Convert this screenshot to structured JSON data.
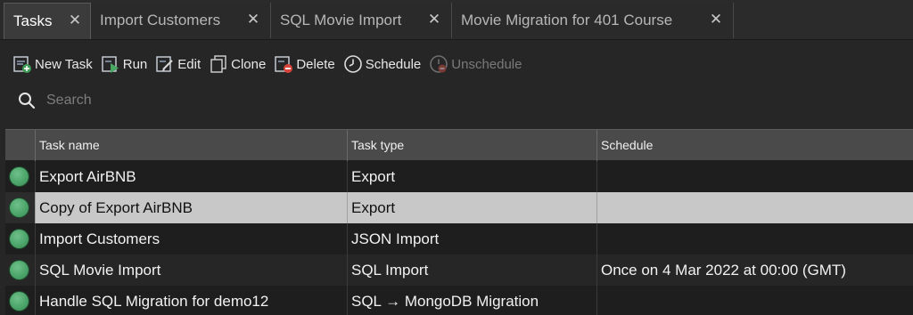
{
  "tabs": [
    {
      "label": "Tasks"
    },
    {
      "label": "Import Customers"
    },
    {
      "label": "SQL Movie Import"
    },
    {
      "label": "Movie Migration for 401 Course"
    }
  ],
  "toolbar": {
    "new_task": "New Task",
    "run": "Run",
    "edit": "Edit",
    "clone": "Clone",
    "delete": "Delete",
    "schedule": "Schedule",
    "unschedule": "Unschedule"
  },
  "search": {
    "placeholder": "Search"
  },
  "table": {
    "columns": [
      "Task name",
      "Task type",
      "Schedule"
    ],
    "rows": [
      {
        "name": "Export AirBNB",
        "type": "Export",
        "schedule": "",
        "status": "green"
      },
      {
        "name": "Copy of Export AirBNB",
        "type": "Export",
        "schedule": "",
        "status": "green",
        "selected": true
      },
      {
        "name": "Import Customers",
        "type": "JSON Import",
        "schedule": "",
        "status": "green"
      },
      {
        "name": "SQL Movie Import",
        "type": "SQL Import",
        "schedule": "Once on 4 Mar 2022 at 00:00 (GMT)",
        "status": "green"
      },
      {
        "name": "Handle SQL Migration for demo12",
        "type": "SQL → MongoDB Migration",
        "schedule": "",
        "status": "green"
      }
    ]
  },
  "colors": {
    "status_green": "#4ca56a",
    "selection": "#c8c8c8"
  }
}
